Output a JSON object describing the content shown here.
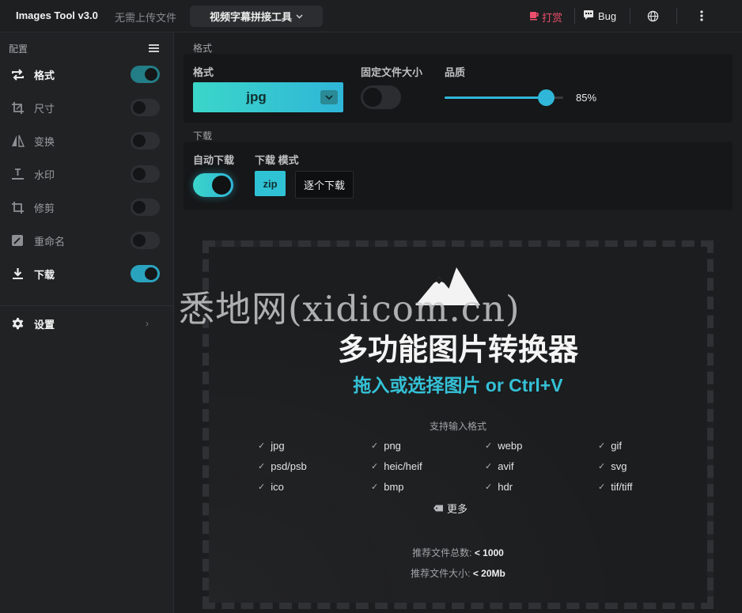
{
  "topbar": {
    "title": "Images Tool v3.0",
    "no_upload": "无需上传文件",
    "tool_select": "视频字幕拼接工具",
    "reward": "打赏",
    "bug": "Bug"
  },
  "sidebar": {
    "header": "配置",
    "items": [
      {
        "label": "格式",
        "icon": "repeat-icon",
        "enabled": true
      },
      {
        "label": "尺寸",
        "icon": "resize-icon",
        "enabled": false
      },
      {
        "label": "变换",
        "icon": "flip-icon",
        "enabled": false
      },
      {
        "label": "水印",
        "icon": "watermark-icon",
        "enabled": false
      },
      {
        "label": "修剪",
        "icon": "crop-icon",
        "enabled": false
      },
      {
        "label": "重命名",
        "icon": "rename-icon",
        "enabled": false
      },
      {
        "label": "下载",
        "icon": "download-icon",
        "enabled": true
      }
    ],
    "settings": "设置"
  },
  "format_section": {
    "section_label": "格式",
    "format_label": "格式",
    "format_value": "jpg",
    "fixed_size_label": "固定文件大小",
    "fixed_size_on": false,
    "quality_label": "品质",
    "quality_value": "85%",
    "quality_level": 0.85
  },
  "download_section": {
    "section_label": "下载",
    "auto_label": "自动下载",
    "auto_on": true,
    "mode_label": "下载 模式",
    "zip_label": "zip",
    "each_label": "逐个下载"
  },
  "dropzone": {
    "watermark": "悉地网(xidicom.cn)",
    "title": "多功能图片转换器",
    "subtitle": "拖入或选择图片 or Ctrl+V",
    "support_label": "支持输入格式",
    "formats": [
      "jpg",
      "png",
      "webp",
      "gif",
      "psd/psb",
      "heic/heif",
      "avif",
      "svg",
      "ico",
      "bmp",
      "hdr",
      "tif/tiff"
    ],
    "more": "更多",
    "count_label": "推荐文件总数: ",
    "count_value": "< 1000",
    "size_label": "推荐文件大小: ",
    "size_value": "< 20Mb"
  },
  "colors": {
    "accent": "#2fb6d8",
    "accent_teal": "#3bd6c9",
    "reward": "#ee4f6d",
    "background": "#1c1d1f"
  }
}
